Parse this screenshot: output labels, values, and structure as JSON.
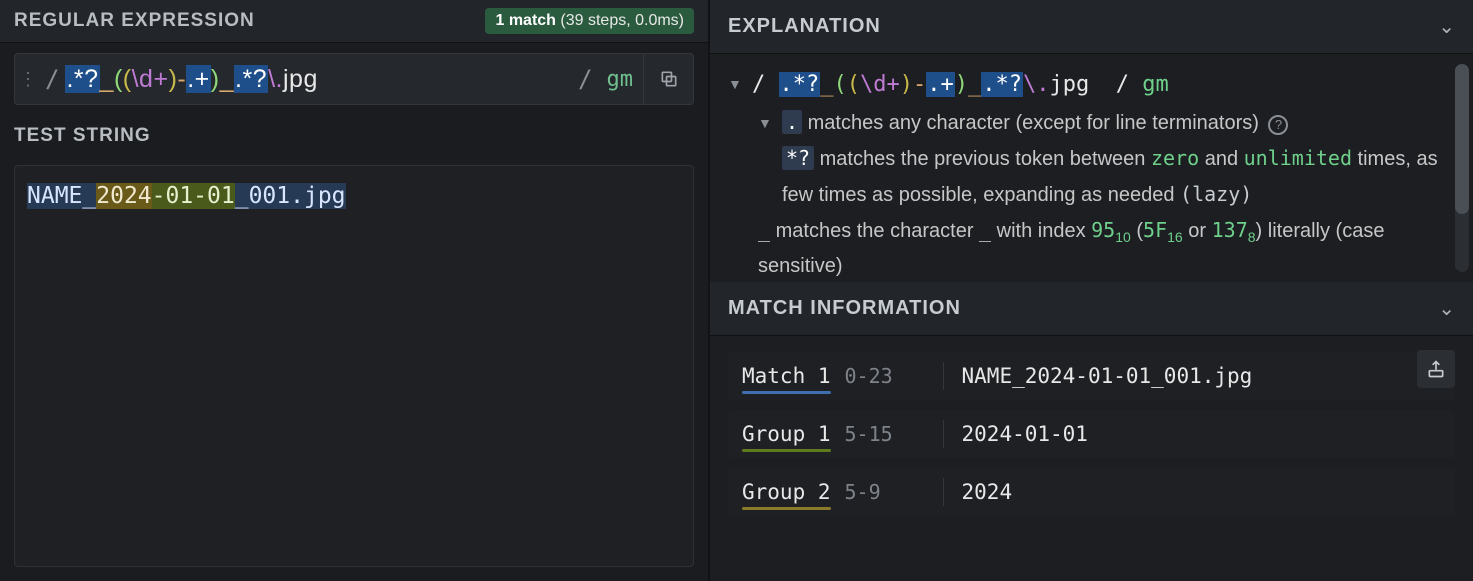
{
  "left": {
    "regex_header": "REGULAR EXPRESSION",
    "badge_bold": "1 match",
    "badge_rest": " (39 steps, 0.0ms)",
    "delim": "/",
    "flags": "gm",
    "test_header": "TEST STRING",
    "test_parts": {
      "pre": "NAME_",
      "g2": "2024",
      "g1rest": "-01-01",
      "postg1": "_001.jpg"
    }
  },
  "regex_tokens": {
    "hl1": ".*?",
    "us": "_",
    "p1o": "(",
    "p2o": "(",
    "dplus": "\\d+",
    "p2c": ")",
    "dash": "-",
    "dotplus": ".+",
    "p1c": ")",
    "hl2": ".*?",
    "escdot": "\\.",
    "jpg": "jpg"
  },
  "explanation": {
    "header": "EXPLANATION",
    "line_dot": " matches any character (except for line terminators)",
    "line_starq_a": " matches the previous token between ",
    "kw_zero": "zero",
    "and": " and ",
    "kw_unl": "unlimited",
    "line_starq_b": " times, as few times as possible, expanding as needed ",
    "lazy": "(lazy)",
    "underscore_a": " matches the character ",
    "underscore_ch": "_",
    "underscore_b": " with index ",
    "v95": "95",
    "s10": "10",
    "paren_o": " (",
    "v5f": "5F",
    "s16": "16",
    "or": " or ",
    "v137": "137",
    "s8": "8",
    "lit_end": ") literally (case sensitive)",
    "tok_dot": ".",
    "tok_starq": "*?",
    "tok_us": "_"
  },
  "match_info": {
    "header": "MATCH INFORMATION",
    "rows": [
      {
        "name": "Match 1",
        "range": "0-23",
        "value": "NAME_2024-01-01_001.jpg"
      },
      {
        "name": "Group 1",
        "range": "5-15",
        "value": "2024-01-01"
      },
      {
        "name": "Group 2",
        "range": "5-9",
        "value": "2024"
      }
    ]
  }
}
